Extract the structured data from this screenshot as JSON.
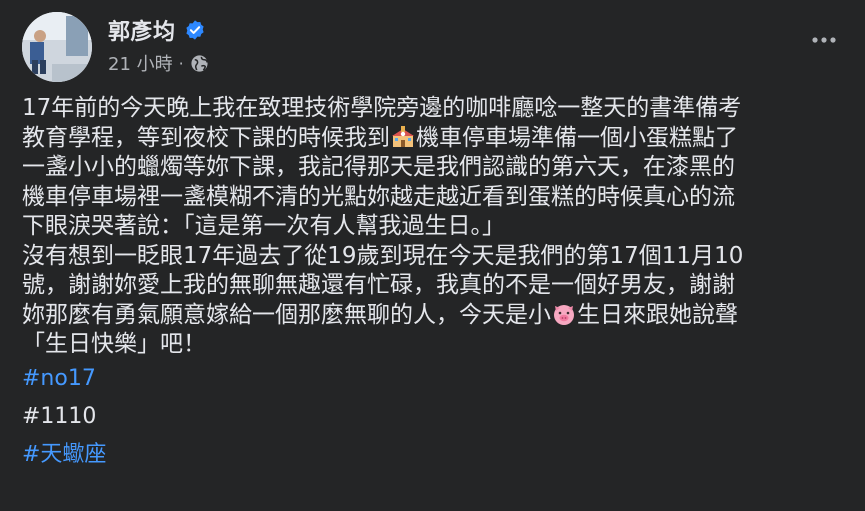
{
  "post": {
    "author": "郭彥均",
    "verified_icon": "verified-badge-icon",
    "timestamp": "21 小時",
    "separator": "·",
    "privacy_icon": "globe-icon",
    "more_icon": "more-options-icon"
  },
  "body": {
    "line1": "17年前的今天晚上我在致理技術學院旁邊的咖啡廳唸一整天的書準備考",
    "line2a": "教育學程，等到夜校下課的時候我到",
    "line2_emoji": "school-emoji-icon",
    "line2b": "機車停車場準備一個小蛋糕點了",
    "line3": "一盞小小的蠟燭等妳下課，我記得那天是我們認識的第六天，在漆黑的",
    "line4": "機車停車場裡一盞模糊不清的光點妳越走越近看到蛋糕的時候真心的流",
    "line5": "下眼淚哭著說：「這是第一次有人幫我過生日。」",
    "line6": "沒有想到一眨眼17年過去了從19歲到現在今天是我們的第17個11月10",
    "line7": "號，謝謝妳愛上我的無聊無趣還有忙碌，我真的不是一個好男友，謝謝",
    "line8a": "妳那麼有勇氣願意嫁給一個那麼無聊的人，今天是小",
    "line8_emoji": "pig-face-emoji-icon",
    "line8b": "生日來跟她說聲",
    "line9": "「生日快樂」吧！"
  },
  "tags": {
    "tag1": "#no17",
    "tag2": "#1110",
    "tag3": "#天蠍座"
  },
  "colors": {
    "background": "#242526",
    "text": "#e4e6eb",
    "secondary_text": "#b0b3b8",
    "link": "#4599ff",
    "verified": "#2d88ff"
  }
}
